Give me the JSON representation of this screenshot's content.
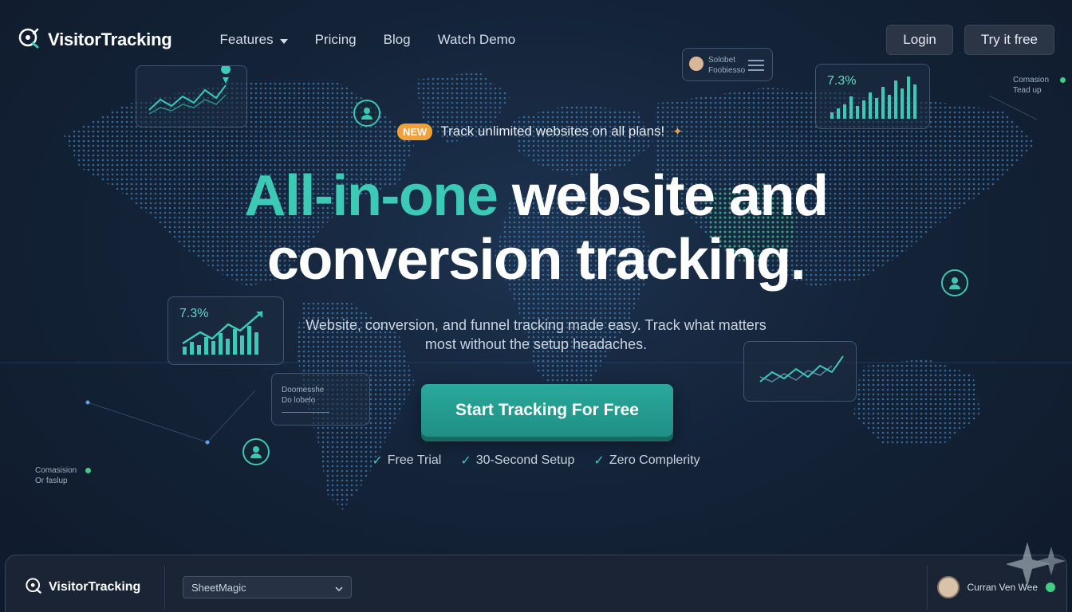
{
  "nav": {
    "brand": "VisitorTracking",
    "links": [
      "Features",
      "Pricing",
      "Blog",
      "Watch Demo"
    ],
    "login": "Login",
    "try": "Try it free"
  },
  "hero": {
    "badge": "NEW",
    "announcement": "Track unlimited websites on all plans!",
    "title_accent": "All-in-one",
    "title_rest1": "website and",
    "title_rest2": "conversion tracking.",
    "subtitle": "Website, conversion, and funnel tracking made easy. Track what matters most without the setup headaches.",
    "cta": "Start Tracking For Free",
    "checks": [
      "Free Trial",
      "30-Second Setup",
      "Zero Complerity"
    ]
  },
  "cards": {
    "stat_left": "7.3%",
    "stat_right": "7.3%",
    "top_mini_line1": "Solobet",
    "top_mini_line2": "Foobiesso",
    "mid_mini_line1": "Doomesshe",
    "mid_mini_line2": "Do lobelo",
    "conv_right_1": "Comasion",
    "conv_right_2": "Tead up",
    "conv_left_1": "Comasision",
    "conv_left_2": "Or faslup"
  },
  "appbar": {
    "brand": "VisitorTracking",
    "select_value": "SheetMagic",
    "user_name": "Curran Ven Wee"
  },
  "colors": {
    "accent": "#3cc9b5",
    "badge": "#f0a13a",
    "cta": "#2aa99c",
    "background": "#142338"
  }
}
